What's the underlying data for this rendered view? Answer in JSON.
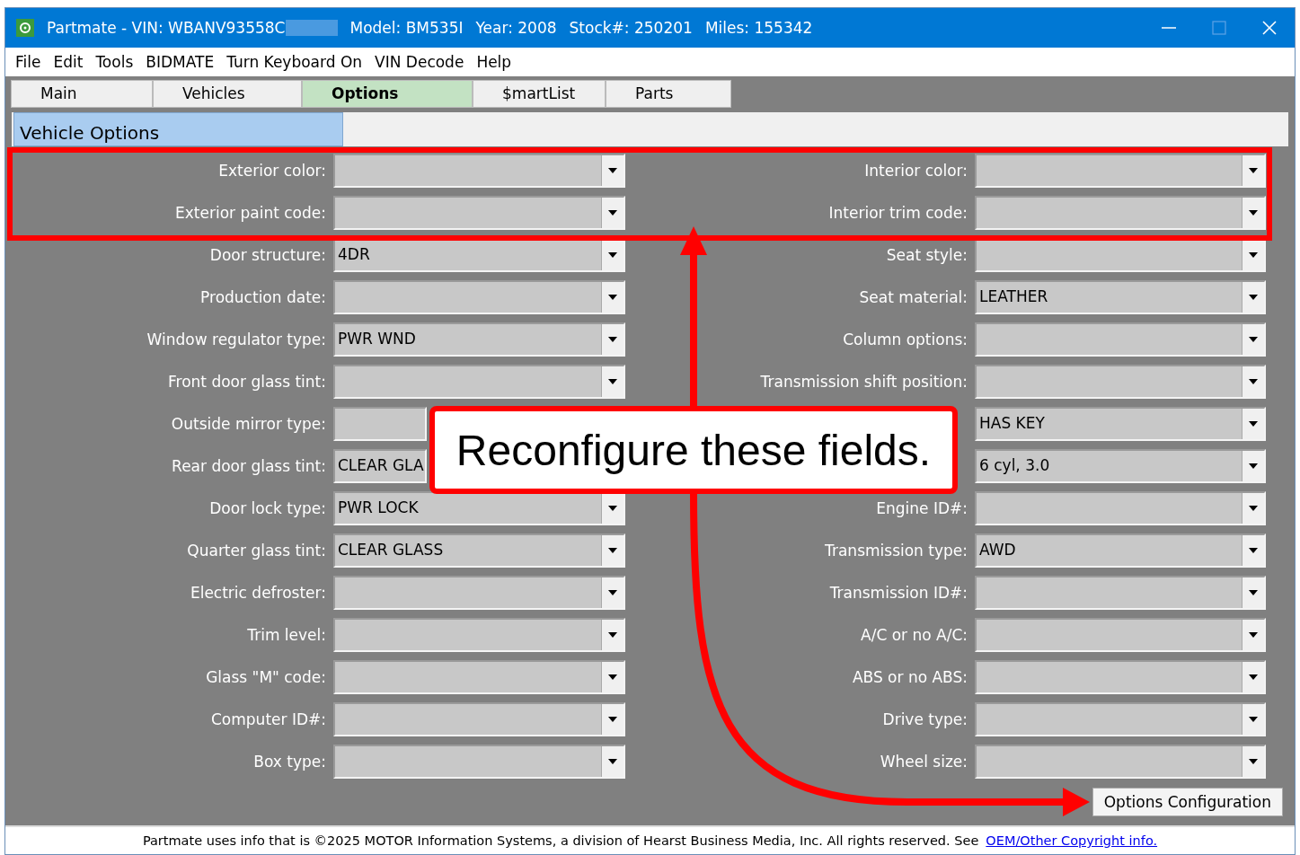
{
  "window": {
    "title_parts": [
      "Partmate -  VIN: WBANV93558C",
      "Model: BM535I",
      "Year: 2008",
      "Stock#: 250201",
      "Miles: 155342"
    ]
  },
  "menu": [
    "File",
    "Edit",
    "Tools",
    "BIDMATE",
    "Turn Keyboard On",
    "VIN Decode",
    "Help"
  ],
  "tabs": [
    {
      "label": "Main",
      "selected": false
    },
    {
      "label": "Vehicles",
      "selected": false
    },
    {
      "label": "Options",
      "selected": true
    },
    {
      "label": "$martList",
      "selected": false
    },
    {
      "label": "Parts",
      "selected": false
    }
  ],
  "section_title": "Vehicle Options",
  "left_fields": [
    {
      "label": "Exterior color:"
    },
    {
      "label": "Exterior paint code:"
    },
    {
      "label": "Door structure:",
      "value": "4DR"
    },
    {
      "label": "Production date:"
    },
    {
      "label": "Window regulator type:",
      "value": "PWR WND"
    },
    {
      "label": "Front door glass tint:"
    },
    {
      "label": "Outside mirror type:",
      "kind": "covered"
    },
    {
      "label": "Rear door glass tint:",
      "value": "CLEAR GLA",
      "kind": "covered"
    },
    {
      "label": "Door lock type:",
      "value": "PWR LOCK"
    },
    {
      "label": "Quarter glass tint:",
      "value": "CLEAR GLASS"
    },
    {
      "label": "Electric defroster:"
    },
    {
      "label": "Trim level:"
    },
    {
      "label": "Glass \"M\" code:"
    },
    {
      "label": "Computer ID#:"
    },
    {
      "label": "Box type:"
    }
  ],
  "right_fields": [
    {
      "label": "Interior color:"
    },
    {
      "label": "Interior trim code:"
    },
    {
      "label": "Seat style:"
    },
    {
      "label": "Seat material:",
      "value": "LEATHER"
    },
    {
      "label": "Column options:"
    },
    {
      "label": "Transmission shift position:"
    },
    {
      "value": "HAS KEY"
    },
    {
      "value": "6 cyl, 3.0"
    },
    {
      "label": "Engine ID#:"
    },
    {
      "label": "Transmission type:",
      "value": "AWD"
    },
    {
      "label": "Transmission ID#:"
    },
    {
      "label": "A/C or no A/C:"
    },
    {
      "label": "ABS or no ABS:"
    },
    {
      "label": "Drive type:"
    },
    {
      "label": "Wheel size:"
    }
  ],
  "config_button": "Options Configuration",
  "footer": {
    "text": "Partmate uses info that is ©2025 MOTOR Information Systems, a division of Hearst Business Media, Inc.  All rights reserved.  See",
    "link": "OEM/Other Copyright info."
  },
  "annotation": {
    "callout": "Reconfigure these fields."
  }
}
